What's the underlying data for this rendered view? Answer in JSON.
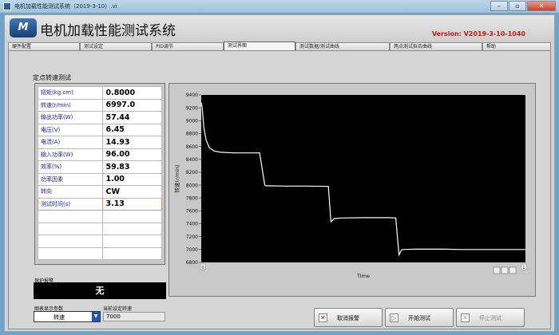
{
  "window": {
    "title": "电机加载性能测试系统（2019-3-10）.vi",
    "buttons": {
      "minimize": "–",
      "maximize": "▫",
      "close": "✕"
    }
  },
  "header": {
    "logo_text": "M",
    "title": "电机加载性能测试系统",
    "version": "Version: V2019-3-10-1040"
  },
  "tabs": [
    {
      "label": "硬件配置",
      "width": 90
    },
    {
      "label": "测试设定",
      "width": 90
    },
    {
      "label": "PID调节",
      "width": 90
    },
    {
      "label": "测试界面",
      "width": 90,
      "active": true
    },
    {
      "label": "测试数据/测试曲线",
      "width": 118
    },
    {
      "label": "两点测试拟合曲线",
      "width": 116
    },
    {
      "label": "帮助",
      "width": 86
    }
  ],
  "section_title": "定点转速测试",
  "params": [
    {
      "label": "扭矩(kg.cm)",
      "value": "0.8000"
    },
    {
      "label": "转速(r/min)",
      "value": "6997.0"
    },
    {
      "label": "输出功率(W)",
      "value": "57.44"
    },
    {
      "label": "电压(V)",
      "value": "6.45"
    },
    {
      "label": "电流(A)",
      "value": "14.93"
    },
    {
      "label": "输入功率(W)",
      "value": "96.00"
    },
    {
      "label": "效率(%)",
      "value": "59.83"
    },
    {
      "label": "功率因素",
      "value": "1.00"
    },
    {
      "label": "转向",
      "value": "CW"
    },
    {
      "label": "测试时间(s)",
      "value": "3.13",
      "selected": true
    },
    {
      "label": "",
      "value": ""
    },
    {
      "label": "",
      "value": ""
    },
    {
      "label": "",
      "value": ""
    },
    {
      "label": "",
      "value": ""
    }
  ],
  "alarm": {
    "label": "保护报警",
    "value": "无"
  },
  "display_param": {
    "label": "图表显示参数",
    "value": "转速"
  },
  "current_speed": {
    "label": "当前设定转速",
    "value": "7000"
  },
  "buttons": {
    "cancel_alarm": "取消报警",
    "start_test": "开始测试",
    "stop_test": "停止测试"
  },
  "chart_data": {
    "type": "line",
    "xlabel": "Time",
    "ylabel": "转速(r/min)",
    "ylim": [
      6800,
      9400
    ],
    "y_ticks": [
      6800,
      7000,
      7200,
      7400,
      7600,
      7800,
      8000,
      8200,
      8400,
      8600,
      8800,
      9000,
      9200,
      9400
    ],
    "x_tick_labels": [
      "0",
      "1"
    ],
    "series": [
      {
        "color": "#ffffff",
        "x": [
          0,
          0.003,
          0.008,
          0.015,
          0.025,
          0.04,
          0.06,
          0.1,
          0.18,
          0.188,
          0.196,
          0.2,
          0.26,
          0.32,
          0.392,
          0.396,
          0.4,
          0.41,
          0.43,
          0.5,
          0.58,
          0.6,
          0.605,
          0.61,
          0.615,
          0.62,
          0.66,
          0.75,
          0.8,
          1.0
        ],
        "y": [
          9280,
          9200,
          8900,
          8700,
          8580,
          8530,
          8510,
          8500,
          8500,
          8250,
          8000,
          7990,
          7985,
          7985,
          7980,
          7700,
          7430,
          7480,
          7490,
          7495,
          7495,
          7490,
          7200,
          6920,
          6970,
          7000,
          7005,
          7005,
          7000,
          7000
        ]
      }
    ],
    "grid": false,
    "background": "#000000"
  }
}
